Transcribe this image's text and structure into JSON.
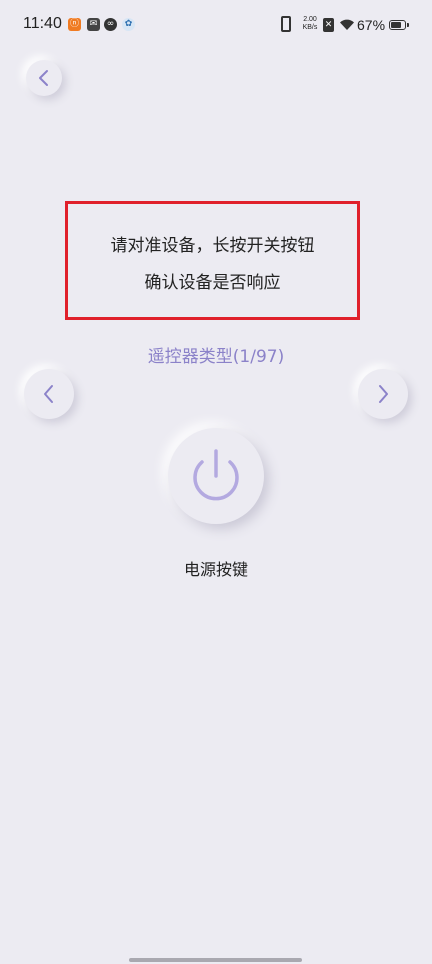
{
  "status_bar": {
    "time": "11:40",
    "network_speed_value": "2.00",
    "network_speed_unit": "KB/s",
    "battery_percent": "67%",
    "notification_icons": [
      "app-notification-icon",
      "message-icon",
      "link-icon",
      "assistant-icon"
    ]
  },
  "instruction": {
    "line1": "请对准设备，长按开关按钮",
    "line2": "确认设备是否响应"
  },
  "remote_type_label": "遥控器类型(1/97)",
  "power_button_label": "电源按键",
  "colors": {
    "accent": "#8b82c9",
    "highlight_border": "#e0202b",
    "background": "#ecebf2"
  }
}
